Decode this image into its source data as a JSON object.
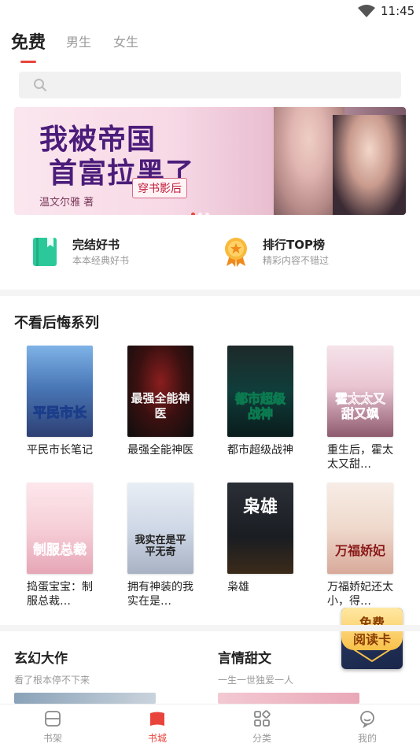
{
  "status_bar": {
    "time": "11:45"
  },
  "tabs": {
    "items": [
      "免费",
      "男生",
      "女生"
    ],
    "active": "免费"
  },
  "search": {
    "placeholder": ""
  },
  "banner": {
    "title_line1": "我被帝国",
    "title_line2": "首富拉黑了",
    "subtitle": "穿书影后",
    "author": "温文尔雅 著"
  },
  "shortcuts": [
    {
      "title": "完结好书",
      "subtitle": "本本经典好书",
      "icon": "book-icon",
      "color": "#2bc99a"
    },
    {
      "title": "排行TOP榜",
      "subtitle": "精彩内容不错过",
      "icon": "rank-medal-icon",
      "color": "#f5a623"
    }
  ],
  "section": {
    "title": "不看后悔系列"
  },
  "books": [
    {
      "name": "平民市长笔记",
      "cover_text": "平民市长"
    },
    {
      "name": "最强全能神医",
      "cover_text": "最强全能神医"
    },
    {
      "name": "都市超级战神",
      "cover_text": "都市超级战神"
    },
    {
      "name": "重生后，霍太太又甜…",
      "cover_text": "霍太太又甜又飒"
    },
    {
      "name": "捣蛋宝宝：制服总裁…",
      "cover_text": "制服总裁"
    },
    {
      "name": "拥有神装的我实在是…",
      "cover_text": "我实在是平平无奇"
    },
    {
      "name": "枭雄",
      "cover_text": "枭雄"
    },
    {
      "name": "万福娇妃还太小，得…",
      "cover_text": "万福娇妃"
    }
  ],
  "ad": {
    "line1": "免费",
    "line2": "阅读卡"
  },
  "categories": [
    {
      "title": "玄幻大作",
      "subtitle": "看了根本停不下来"
    },
    {
      "title": "言情甜文",
      "subtitle": "一生一世独爱一人"
    }
  ],
  "bottom_nav": [
    {
      "label": "书架",
      "icon": "bookshelf-icon",
      "active": false
    },
    {
      "label": "书城",
      "icon": "bookstore-icon",
      "active": true
    },
    {
      "label": "分类",
      "icon": "category-icon",
      "active": false
    },
    {
      "label": "我的",
      "icon": "profile-icon",
      "active": false
    }
  ],
  "colors": {
    "accent": "#e8443b",
    "muted": "#999999"
  }
}
